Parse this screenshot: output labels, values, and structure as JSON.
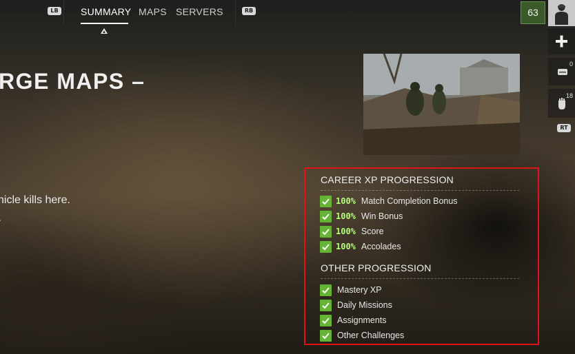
{
  "nav": {
    "left_hint": "LB",
    "right_hint": "RB",
    "tabs": [
      {
        "label": "SUMMARY",
        "active": true
      },
      {
        "label": "MAPS",
        "active": false
      },
      {
        "label": "SERVERS",
        "active": false
      }
    ]
  },
  "player": {
    "level": "63",
    "avatar_icon": "soldier-avatar-icon"
  },
  "rail": {
    "add_icon": "plus-icon",
    "item1": {
      "icon": "dog-tag-icon",
      "count": "0"
    },
    "item2": {
      "icon": "gloves-icon",
      "count": "18"
    },
    "trigger_hint": "RT"
  },
  "mode": {
    "title_visible": "RGE MAPS –",
    "description_visible": "hicle kills here.",
    "description_line2": "."
  },
  "progression": {
    "career_title": "CAREER XP PROGRESSION",
    "career_items": [
      {
        "percent": "100%",
        "label": "Match Completion Bonus"
      },
      {
        "percent": "100%",
        "label": "Win Bonus"
      },
      {
        "percent": "100%",
        "label": "Score"
      },
      {
        "percent": "100%",
        "label": "Accolades"
      }
    ],
    "other_title": "OTHER PROGRESSION",
    "other_items": [
      {
        "label": "Mastery XP"
      },
      {
        "label": "Daily Missions"
      },
      {
        "label": "Assignments"
      },
      {
        "label": "Other Challenges"
      }
    ]
  },
  "colors": {
    "highlight_border": "#e01414",
    "check_green": "#66b436",
    "percent_green": "#b6ff7a",
    "level_badge": "#3a5a2a"
  }
}
